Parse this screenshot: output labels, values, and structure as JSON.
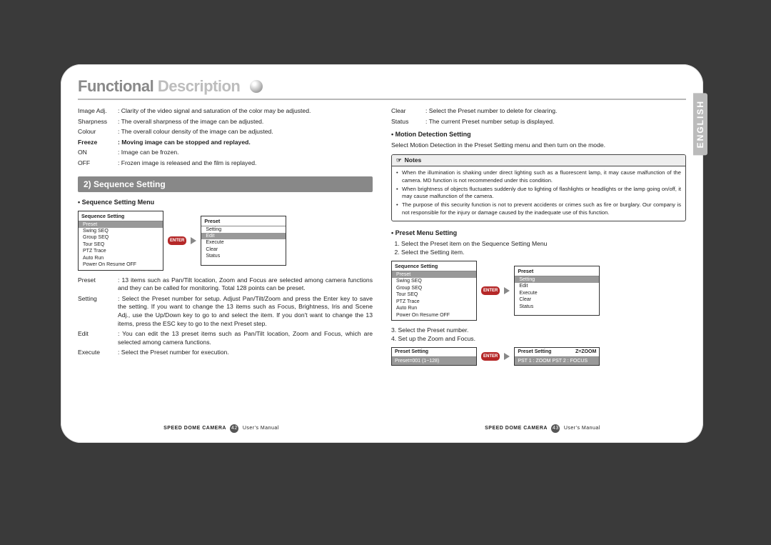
{
  "header": {
    "functional": "Functional",
    "description": " Description"
  },
  "language_tab": "ENGLISH",
  "left": {
    "imageAdj": {
      "label": "Image Adj.",
      "text": ": Clarity of the video signal and saturation of the color may be adjusted."
    },
    "sharpness": {
      "label": "Sharpness",
      "text": ": The overall sharpness of the image can be adjusted."
    },
    "colour": {
      "label": "Colour",
      "text": ": The overall colour density of the image can be adjusted."
    },
    "freeze": {
      "label": "Freeze",
      "text": ": Moving image can be stopped and replayed."
    },
    "on": {
      "label": "ON",
      "text": ": Image can be frozen."
    },
    "off": {
      "label": "OFF",
      "text": ": Frozen image is released and the film is replayed."
    },
    "section_title": "2) Sequence Setting",
    "bullet_menu": "• Sequence Setting Menu",
    "seq_menu_title": "Sequence Setting",
    "seq_items": [
      "Preset",
      "Swing SEQ",
      "Group SEQ",
      "Tour SEQ",
      "PTZ Trace",
      "Auto Run",
      "Power On Resume OFF"
    ],
    "preset_menu_title": "Preset",
    "preset_items": [
      "Setting",
      "Edit",
      "Execute",
      "Clear",
      "Status"
    ],
    "enter": "ENTER",
    "preset": {
      "label": "Preset",
      "text": ": 13 items such as Pan/Tilt location, Zoom and Focus are selected among camera functions and they can be called for monitoring. Total 128 points can be preset."
    },
    "setting": {
      "label": "Setting",
      "text": ": Select the Preset number for setup. Adjust Pan/Tilt/Zoom and press the Enter key to save the setting. If you want to change the 13 items such as Focus, Brightness, Iris and Scene Adj., use the Up/Down key to go to and select the item. If you don't want to change the 13 items, press the ESC key to go to the next Preset step."
    },
    "edit": {
      "label": "Edit",
      "text": ": You can edit the 13 preset items such as Pan/Tilt location, Zoom and Focus, which are selected among camera functions."
    },
    "execute": {
      "label": "Execute",
      "text": ": Select the Preset number for execution."
    }
  },
  "right": {
    "clear": {
      "label": "Clear",
      "text": ": Select the Preset number to delete for clearing."
    },
    "status": {
      "label": "Status",
      "text": ": The current Preset number setup is displayed."
    },
    "mds_title": "• Motion Detection Setting",
    "mds_text": "Select Motion Detection in the Preset Setting menu and then turn on the mode.",
    "notes_title": "Notes",
    "notes": [
      "When the illumination is shaking under direct lighting such as a fluorescent lamp, it may cause malfunction of the camera. MD function is not recommended under this condition.",
      "When brightness of objects fluctuates suddenly due to lighting of flashlights or headlights or the lamp going on/off, it may cause malfunction of the camera.",
      "The purpose of this security function is not to prevent accidents or crimes such as fire or burglary. Our company is not responsible for the injury or damage caused by the inadequate use of this function."
    ],
    "pms_title": "• Preset Menu Setting",
    "pms_steps12": [
      "Select the Preset item on the Sequence Setting Menu",
      "Select the Setting item."
    ],
    "seq_menu_title": "Sequence Setting",
    "seq_items": [
      "Preset",
      "Swing SEQ",
      "Group SEQ",
      "Tour SEQ",
      "PTZ Trace",
      "Auto Run",
      "Power On Resume OFF"
    ],
    "preset_menu_title": "Preset",
    "preset_items": [
      "Setting",
      "Edit",
      "Execute",
      "Clear",
      "Status"
    ],
    "enter": "ENTER",
    "pms_step3": "3. Select the Preset number.",
    "pms_step4": "4. Set up the Zoom and Focus.",
    "bar1_title": "Preset Setting",
    "bar1_row": "Preset=001 (1~128)",
    "bar2_title_l": "Preset Setting",
    "bar2_title_r": "Z=ZOOM",
    "bar2_row": "PST 1 : ZOOM  PST 2 : FOCUS"
  },
  "footer": {
    "left_text_a": "SPEED DOME CAMERA",
    "left_num": "42",
    "left_text_b": "User's Manual",
    "right_text_a": "SPEED DOME CAMERA",
    "right_num": "43",
    "right_text_b": "User's Manual"
  }
}
